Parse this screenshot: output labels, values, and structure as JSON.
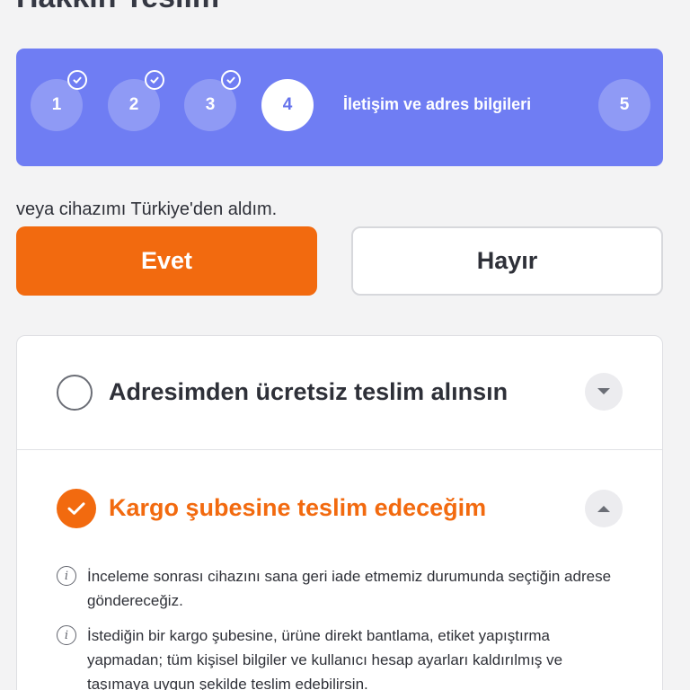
{
  "page": {
    "top_heading": "Hakkın Teslim"
  },
  "stepper": {
    "steps": [
      {
        "number": "1",
        "state": "done"
      },
      {
        "number": "2",
        "state": "done"
      },
      {
        "number": "3",
        "state": "done"
      },
      {
        "number": "4",
        "state": "current"
      },
      {
        "number": "5",
        "state": "future"
      }
    ],
    "current_label": "İletişim ve adres bilgileri",
    "colors": {
      "background": "#6f7df3",
      "current_bg": "#ffffff",
      "current_fg": "#6673ec",
      "inactive_bg": "#8f9af5"
    }
  },
  "question": {
    "faded_text": "",
    "text": "veya cihazımı Türkiye'den aldım.",
    "yes_label": "Evet",
    "no_label": "Hayır",
    "selected": "Evet"
  },
  "delivery": {
    "options": [
      {
        "label": "Adresimden ücretsiz teslim alınsın",
        "selected": false,
        "expanded": false
      },
      {
        "label": "Kargo şubesine teslim edeceğim",
        "selected": true,
        "expanded": true
      }
    ],
    "info_items": [
      "İnceleme sonrası cihazını sana geri iade etmemiz durumunda seçtiğin adrese göndereceğiz.",
      "İstediğin bir kargo şubesine, ürüne direkt bantlama, etiket yapıştırma yapmadan; tüm kişisel bilgiler ve kullanıcı hesap ayarları kaldırılmış ve taşımaya uygun şekilde teslim edebilirsin."
    ]
  },
  "colors": {
    "accent": "#f26a0f",
    "stepper_bg": "#6f7df3"
  },
  "icons": {
    "check": "check-icon",
    "info": "info-icon",
    "chevron_down": "chevron-down-icon",
    "chevron_up": "chevron-up-icon"
  }
}
